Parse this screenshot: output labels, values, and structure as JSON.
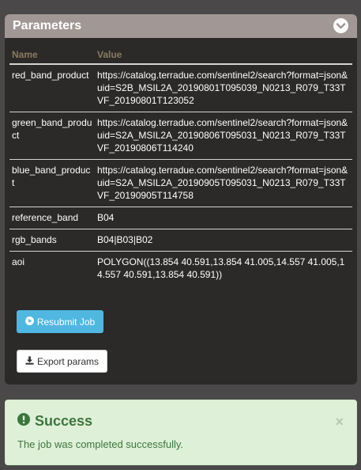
{
  "panel": {
    "title": "Parameters",
    "collapse_icon": "chevron-down-circle-icon",
    "header_color": "#a19895"
  },
  "table": {
    "headers": {
      "name": "Name",
      "value": "Value"
    },
    "rows": [
      {
        "name": "red_band_product",
        "value": "https://catalog.terradue.com/sentinel2/search?format=json&uid=S2B_MSIL2A_20190801T095039_N0213_R079_T33TVF_20190801T123052"
      },
      {
        "name": "green_band_product",
        "value": "https://catalog.terradue.com/sentinel2/search?format=json&uid=S2A_MSIL2A_20190806T095031_N0213_R079_T33TVF_20190806T114240"
      },
      {
        "name": "blue_band_product",
        "value": "https://catalog.terradue.com/sentinel2/search?format=json&uid=S2A_MSIL2A_20190905T095031_N0213_R079_T33TVF_20190905T114758"
      },
      {
        "name": "reference_band",
        "value": "B04"
      },
      {
        "name": "rgb_bands",
        "value": "B04|B03|B02"
      },
      {
        "name": "aoi",
        "value": "POLYGON((13.854 40.591,13.854 41.005,14.557 41.005,14.557 40.591,13.854 40.591))"
      }
    ]
  },
  "buttons": {
    "resubmit_label": "Resubmit Job",
    "resubmit_icon": "play-circle-icon",
    "export_label": "Export params",
    "export_icon": "download-icon"
  },
  "alert": {
    "title": "Success",
    "message": "The job was completed successfully.",
    "icon": "exclamation-circle-icon",
    "close": "×"
  }
}
